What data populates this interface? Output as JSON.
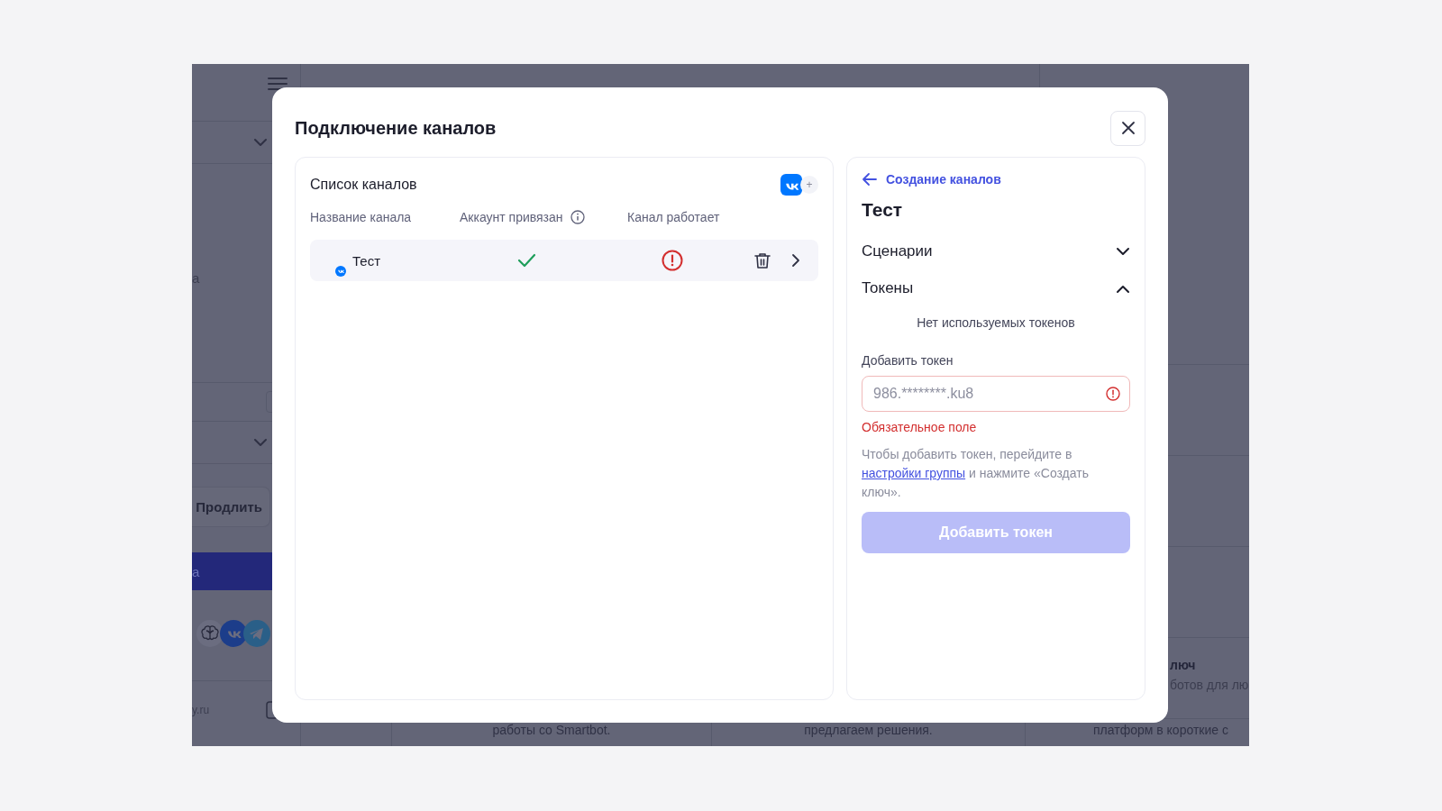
{
  "background": {
    "sidebar": {
      "fragment": "а",
      "renew_button": "Продлить",
      "banner_fragment": "а",
      "footer_fragment": "y.ru"
    },
    "content": {
      "feature_title": "люч",
      "feature_line": "ботов для лю",
      "bottom_texts": [
        "работы со Smartbot.",
        "предлагаем решения.",
        "платформ в короткие с"
      ]
    }
  },
  "modal": {
    "title": "Подключение каналов",
    "channel_list": {
      "title": "Список каналов",
      "add_plus": "+",
      "columns": [
        "Название канала",
        "Аккаунт привязан",
        "Канал работает"
      ],
      "rows": [
        {
          "name": "Тест",
          "account_linked": true,
          "channel_working": false
        }
      ]
    },
    "channel_panel": {
      "back_link": "Создание каналов",
      "title": "Тест",
      "sections": [
        {
          "title": "Сценарии",
          "expanded": false
        },
        {
          "title": "Токены",
          "expanded": true
        }
      ],
      "empty_tokens": "Нет используемых токенов",
      "field_label": "Добавить токен",
      "token_field": {
        "placeholder": "986.********.ku8",
        "invalid": true
      },
      "error": "Обязательное поле",
      "help": {
        "before": "Чтобы добавить токен, перейдите в",
        "link": "настройки группы",
        "after": "и нажмите «Создать ключ»."
      },
      "add_button": {
        "label": "Добавить токен",
        "disabled": true
      }
    }
  }
}
